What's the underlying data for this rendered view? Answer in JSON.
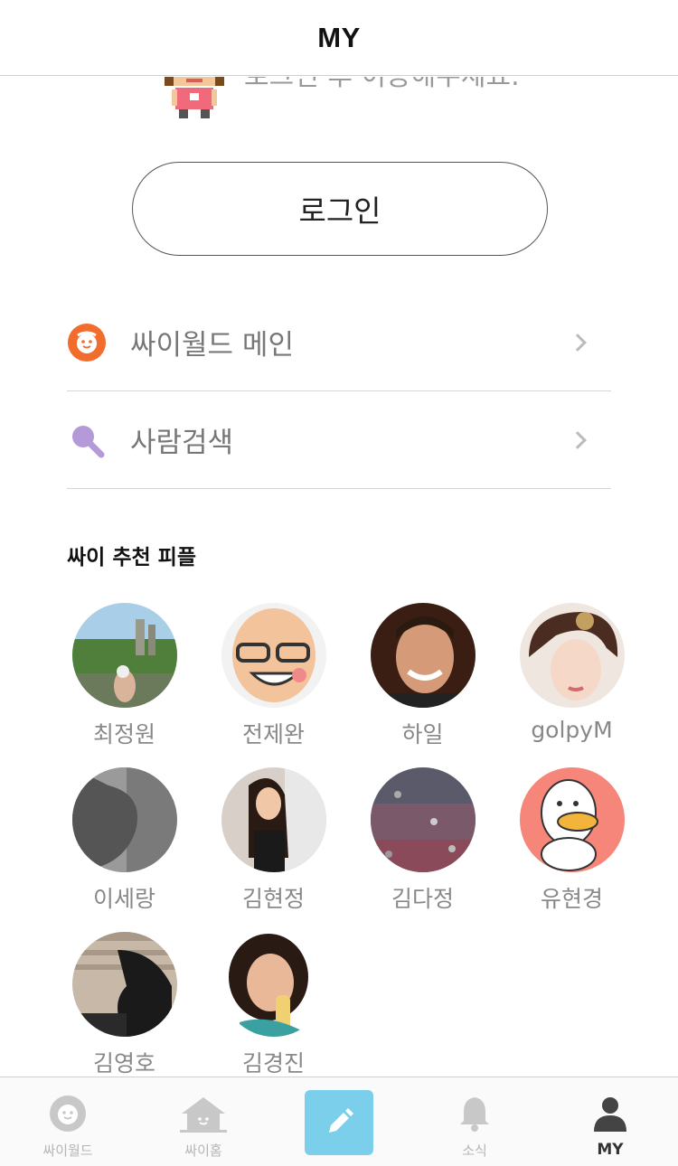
{
  "header": {
    "title": "MY"
  },
  "login": {
    "notice": "로그인 후 이용해주세요.",
    "button_label": "로그인"
  },
  "menu": [
    {
      "label": "싸이월드 메인",
      "icon": "cyworld-face-icon"
    },
    {
      "label": "사람검색",
      "icon": "search-icon"
    }
  ],
  "recommended": {
    "title": "싸이 추천 피플",
    "people": [
      {
        "name": "최정원"
      },
      {
        "name": "전제완"
      },
      {
        "name": "하일"
      },
      {
        "name": "golpyM"
      },
      {
        "name": "이세랑"
      },
      {
        "name": "김현정"
      },
      {
        "name": "김다정"
      },
      {
        "name": "유현경"
      },
      {
        "name": "김영호"
      },
      {
        "name": "김경진"
      }
    ]
  },
  "tabbar": {
    "tabs": [
      {
        "label": "싸이월드",
        "icon": "cyworld-face-icon"
      },
      {
        "label": "싸이홈",
        "icon": "home-icon"
      },
      {
        "label": "",
        "icon": "pencil-icon"
      },
      {
        "label": "소식",
        "icon": "bell-icon"
      },
      {
        "label": "MY",
        "icon": "person-icon"
      }
    ],
    "active": "MY",
    "colors": {
      "write_button": "#7ccfeb",
      "accent_orange": "#f26d2d",
      "search_purple": "#b49ad8"
    }
  }
}
